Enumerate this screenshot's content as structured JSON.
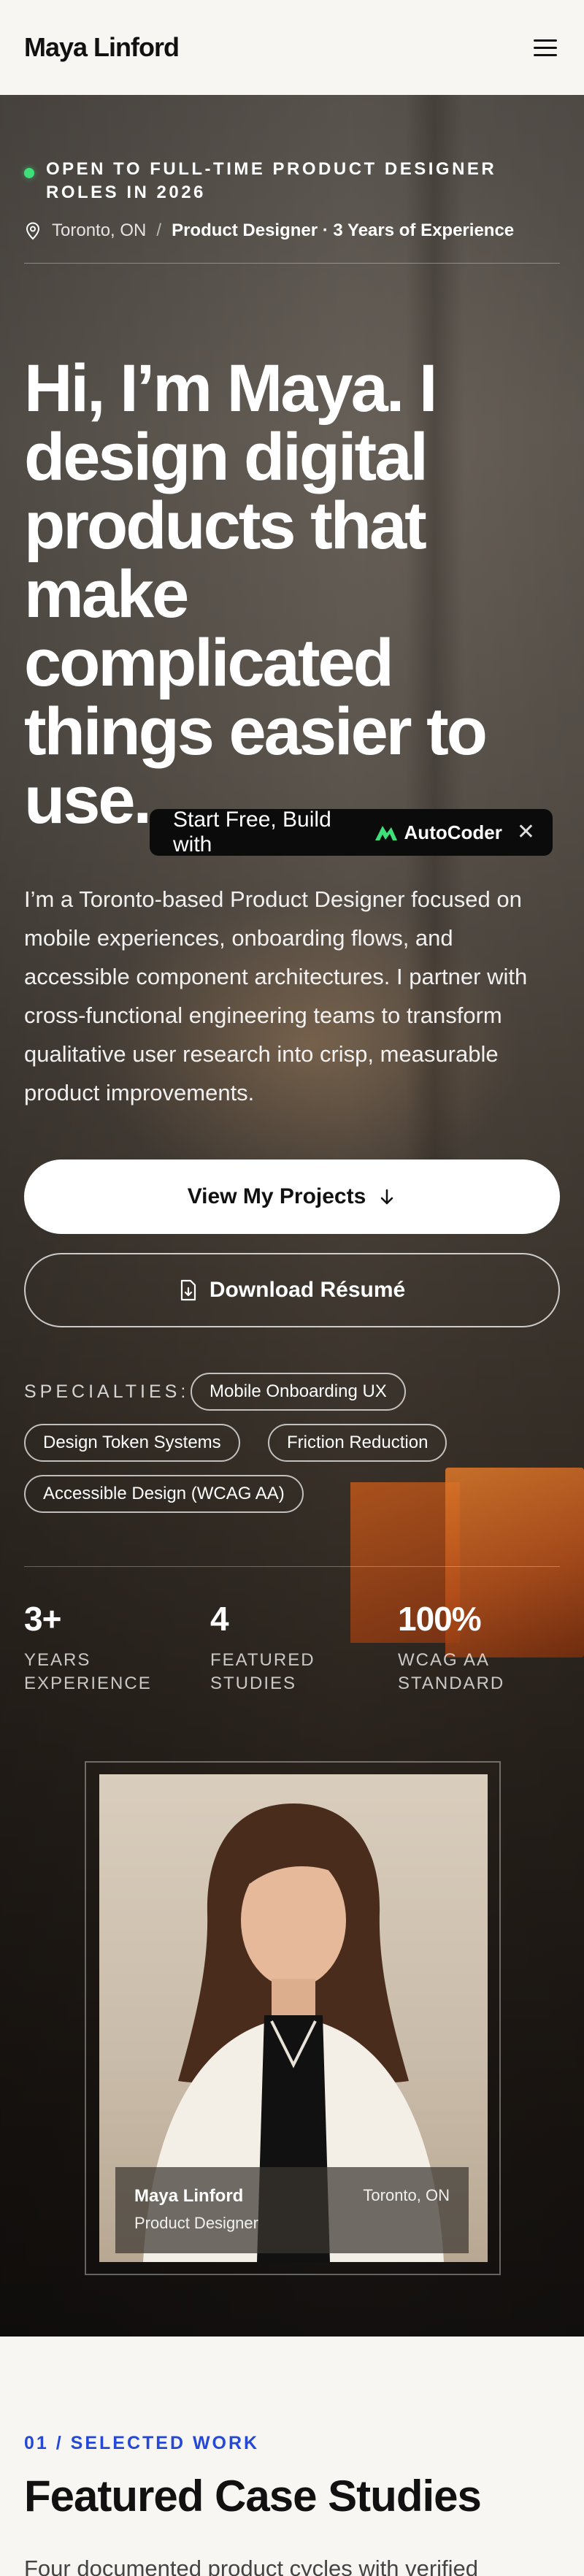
{
  "header": {
    "brand": "Maya Linford"
  },
  "hero": {
    "status": "OPEN TO FULL-TIME PRODUCT DESIGNER ROLES IN 2026",
    "location": "Toronto, ON",
    "separator": "/",
    "role": "Product Designer · 3 Years of Experience",
    "title": "Hi, I’m Maya. I design digital products that make complicated things easier to use.",
    "description": "I’m a Toronto-based Product Designer focused on mobile experiences, onboarding flows, and accessible component architectures. I partner with cross-functional engineering teams to transform qualitative user research into crisp, measurable product improvements.",
    "primary_button": "View My Projects",
    "secondary_button": "Download Résumé",
    "specialties_label": "SPECIALTIES:",
    "specialties": [
      "Mobile Onboarding UX",
      "Design Token Systems",
      "Friction Reduction",
      "Accessible Design (WCAG AA)"
    ],
    "stats": [
      {
        "value": "3+",
        "label": "YEARS EXPERIENCE"
      },
      {
        "value": "4",
        "label": "FEATURED STUDIES"
      },
      {
        "value": "100%",
        "label": "WCAG AA STANDARD"
      }
    ],
    "portrait_card": {
      "name": "Maya Linford",
      "role": "Product Designer",
      "location": "Toronto, ON"
    }
  },
  "promo": {
    "text": "Start Free, Build with",
    "logo_name": "AutoCoder"
  },
  "work": {
    "eyebrow": "01 / SELECTED WORK",
    "title": "Featured Case Studies",
    "description": "Four documented product cycles with verified"
  },
  "colors": {
    "accent": "#2448d8",
    "status": "#3ee07a",
    "promo_bg": "#0b0b0b"
  }
}
